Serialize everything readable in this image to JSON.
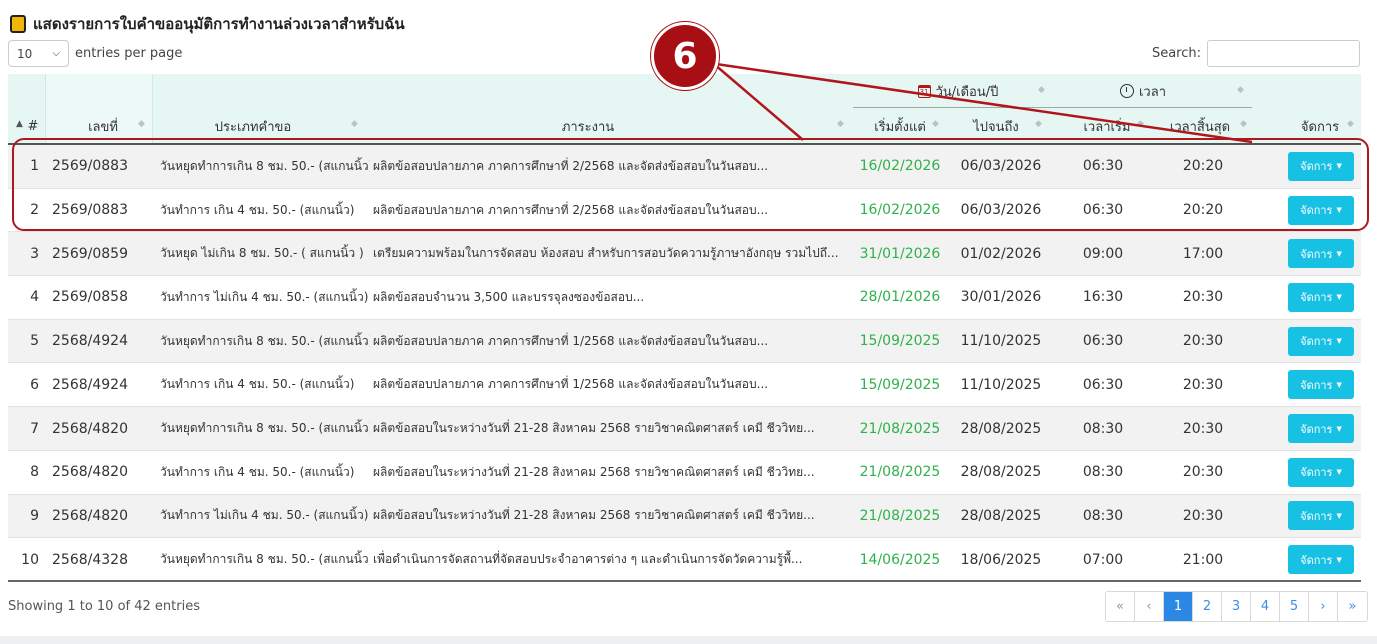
{
  "title": "แสดงรายการใบคำขออนุมัติการทำงานล่วงเวลาสำหรับฉัน",
  "length": {
    "value": "10",
    "label": "entries per page"
  },
  "search": {
    "label": "Search:",
    "value": "",
    "placeholder": ""
  },
  "callout_label": "6",
  "columns": {
    "idx": "#",
    "no": "เลขที่",
    "type": "ประเภทคำขอ",
    "task": "ภาระงาน",
    "date_group": "วัน/เดือน/ปี",
    "time_group": "เวลา",
    "start_date": "เริ่มตั้งแต่",
    "end_date": "ไปจนถึง",
    "start_time": "เวลาเริ่ม",
    "end_time": "เวลาสิ้นสุด",
    "action": "จัดการ"
  },
  "rows": [
    {
      "idx": "1",
      "no": "2569/0883",
      "type": "วันหยุดทำการเกิน 8 ชม. 50.- (สแกนนิ้ว)",
      "task": "ผลิตข้อสอบปลายภาค ภาคการศึกษาที่ 2/2568 และจัดส่งข้อสอบในวันสอบ...",
      "start_date": "16/02/2026",
      "end_date": "06/03/2026",
      "start_time": "06:30",
      "end_time": "20:20",
      "action": "จัดการ"
    },
    {
      "idx": "2",
      "no": "2569/0883",
      "type": "วันทำการ เกิน 4 ชม. 50.- (สแกนนิ้ว)",
      "task": "ผลิตข้อสอบปลายภาค ภาคการศึกษาที่ 2/2568 และจัดส่งข้อสอบในวันสอบ...",
      "start_date": "16/02/2026",
      "end_date": "06/03/2026",
      "start_time": "06:30",
      "end_time": "20:20",
      "action": "จัดการ"
    },
    {
      "idx": "3",
      "no": "2569/0859",
      "type": "วันหยุด ไม่เกิน 8 ชม. 50.- ( สแกนนิ้ว )",
      "task": "เตรียมความพร้อมในการจัดสอบ ห้องสอบ สำหรับการสอบวัดความรู้ภาษาอังกฤษ รวมไปถึ...",
      "start_date": "31/01/2026",
      "end_date": "01/02/2026",
      "start_time": "09:00",
      "end_time": "17:00",
      "action": "จัดการ"
    },
    {
      "idx": "4",
      "no": "2569/0858",
      "type": "วันทำการ ไม่เกิน 4 ชม. 50.- (สแกนนิ้ว)",
      "task": "ผลิตข้อสอบจำนวน 3,500 และบรรจุลงซองข้อสอบ...",
      "start_date": "28/01/2026",
      "end_date": "30/01/2026",
      "start_time": "16:30",
      "end_time": "20:30",
      "action": "จัดการ"
    },
    {
      "idx": "5",
      "no": "2568/4924",
      "type": "วันหยุดทำการเกิน 8 ชม. 50.- (สแกนนิ้ว)",
      "task": "ผลิตข้อสอบปลายภาค ภาคการศึกษาที่ 1/2568 และจัดส่งข้อสอบในวันสอบ...",
      "start_date": "15/09/2025",
      "end_date": "11/10/2025",
      "start_time": "06:30",
      "end_time": "20:30",
      "action": "จัดการ"
    },
    {
      "idx": "6",
      "no": "2568/4924",
      "type": "วันทำการ เกิน 4 ชม. 50.- (สแกนนิ้ว)",
      "task": "ผลิตข้อสอบปลายภาค ภาคการศึกษาที่ 1/2568 และจัดส่งข้อสอบในวันสอบ...",
      "start_date": "15/09/2025",
      "end_date": "11/10/2025",
      "start_time": "06:30",
      "end_time": "20:30",
      "action": "จัดการ"
    },
    {
      "idx": "7",
      "no": "2568/4820",
      "type": "วันหยุดทำการเกิน 8 ชม. 50.- (สแกนนิ้ว)",
      "task": "ผลิตข้อสอบในระหว่างวันที่ 21-28 สิงหาคม 2568 รายวิชาคณิตศาสตร์ เคมี ชีววิทย...",
      "start_date": "21/08/2025",
      "end_date": "28/08/2025",
      "start_time": "08:30",
      "end_time": "20:30",
      "action": "จัดการ"
    },
    {
      "idx": "8",
      "no": "2568/4820",
      "type": "วันทำการ เกิน 4 ชม. 50.- (สแกนนิ้ว)",
      "task": "ผลิตข้อสอบในระหว่างวันที่ 21-28 สิงหาคม 2568 รายวิชาคณิตศาสตร์ เคมี ชีววิทย...",
      "start_date": "21/08/2025",
      "end_date": "28/08/2025",
      "start_time": "08:30",
      "end_time": "20:30",
      "action": "จัดการ"
    },
    {
      "idx": "9",
      "no": "2568/4820",
      "type": "วันทำการ ไม่เกิน 4 ชม. 50.- (สแกนนิ้ว)",
      "task": "ผลิตข้อสอบในระหว่างวันที่ 21-28 สิงหาคม 2568 รายวิชาคณิตศาสตร์ เคมี ชีววิทย...",
      "start_date": "21/08/2025",
      "end_date": "28/08/2025",
      "start_time": "08:30",
      "end_time": "20:30",
      "action": "จัดการ"
    },
    {
      "idx": "10",
      "no": "2568/4328",
      "type": "วันหยุดทำการเกิน 8 ชม. 50.- (สแกนนิ้ว)",
      "task": "เพื่อดำเนินการจัดสถานที่จัดสอบประจำอาคารต่าง ๆ และดำเนินการจัดวัดความรู้พื้...",
      "start_date": "14/06/2025",
      "end_date": "18/06/2025",
      "start_time": "07:00",
      "end_time": "21:00",
      "action": "จัดการ"
    }
  ],
  "info": "Showing 1 to 10 of 42 entries",
  "pagination": {
    "first": "«",
    "prev": "‹",
    "pages": [
      "1",
      "2",
      "3",
      "4",
      "5"
    ],
    "current": "1",
    "next": "›",
    "last": "»"
  },
  "colors": {
    "accent": "#17c1e3",
    "date_green": "#2fb24a",
    "header_bg": "#e6f7f3",
    "annotation_red": "#b0171c",
    "pager_active": "#2b88e4"
  },
  "icons": {
    "title": "yellow-square-icon",
    "date": "calendar-icon",
    "time": "clock-icon"
  }
}
